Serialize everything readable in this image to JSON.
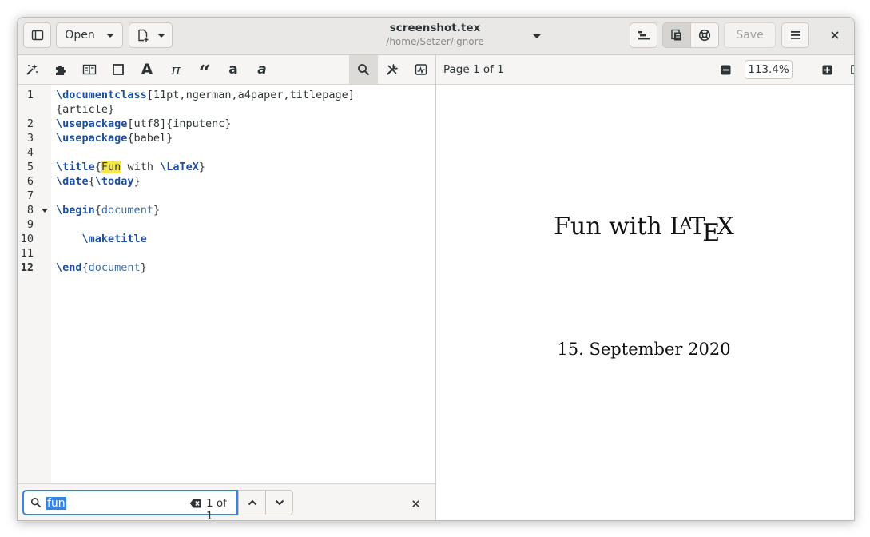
{
  "header": {
    "open_label": "Open",
    "title": "screenshot.tex",
    "subtitle": "/home/Setzer/ignore",
    "save_label": "Save"
  },
  "icons": {
    "sidebar": "sidebar-toggle-icon",
    "new_doc": "new-document-icon",
    "structure": "document-structure-icon",
    "preview_toggle": "preview-pane-icon",
    "help": "help-lifebuoy-icon",
    "menu": "hamburger-menu-icon",
    "close": "close-icon"
  },
  "editor": {
    "lines": [
      {
        "num": "1",
        "parts": [
          {
            "t": "\\documentclass",
            "c": "kw"
          },
          {
            "t": "[11pt,ngerman,a4paper,titlepage]",
            "c": ""
          }
        ]
      },
      {
        "num": "",
        "parts": [
          {
            "t": "{article}",
            "c": ""
          }
        ]
      },
      {
        "num": "2",
        "parts": [
          {
            "t": "\\usepackage",
            "c": "kw"
          },
          {
            "t": "[utf8]{inputenc}",
            "c": ""
          }
        ]
      },
      {
        "num": "3",
        "parts": [
          {
            "t": "\\usepackage",
            "c": "kw"
          },
          {
            "t": "{babel}",
            "c": ""
          }
        ]
      },
      {
        "num": "4",
        "parts": []
      },
      {
        "num": "5",
        "parts": [
          {
            "t": "\\title",
            "c": "kw"
          },
          {
            "t": "{",
            "c": ""
          },
          {
            "t": "Fun",
            "c": "hl"
          },
          {
            "t": " with ",
            "c": ""
          },
          {
            "t": "\\LaTeX",
            "c": "kw"
          },
          {
            "t": "}",
            "c": ""
          }
        ]
      },
      {
        "num": "6",
        "parts": [
          {
            "t": "\\date",
            "c": "kw"
          },
          {
            "t": "{",
            "c": ""
          },
          {
            "t": "\\today",
            "c": "kw"
          },
          {
            "t": "}",
            "c": ""
          }
        ]
      },
      {
        "num": "7",
        "parts": []
      },
      {
        "num": "8",
        "parts": [
          {
            "t": "\\begin",
            "c": "kw"
          },
          {
            "t": "{",
            "c": ""
          },
          {
            "t": "document",
            "c": "arg"
          },
          {
            "t": "}",
            "c": ""
          }
        ],
        "fold": true
      },
      {
        "num": "9",
        "parts": []
      },
      {
        "num": "10",
        "parts": [
          {
            "t": "    ",
            "c": ""
          },
          {
            "t": "\\maketitle",
            "c": "kw"
          }
        ]
      },
      {
        "num": "11",
        "parts": []
      },
      {
        "num": "12",
        "parts": [
          {
            "t": "\\end",
            "c": "kw"
          },
          {
            "t": "{",
            "c": ""
          },
          {
            "t": "document",
            "c": "arg"
          },
          {
            "t": "}",
            "c": ""
          }
        ],
        "current": true
      }
    ]
  },
  "search": {
    "query": "fun",
    "match_count": "1 of 1"
  },
  "preview": {
    "page_label": "Page 1 of 1",
    "zoom": "113.4%",
    "doc_title_prefix": "Fun with ",
    "latex_l": "L",
    "latex_a": "A",
    "latex_t": "T",
    "latex_e": "E",
    "latex_x": "X",
    "doc_date": "15. September 2020"
  },
  "colors": {
    "accent": "#3584e4",
    "keyword": "#1e4e9c",
    "highlight": "#f6e64a"
  }
}
